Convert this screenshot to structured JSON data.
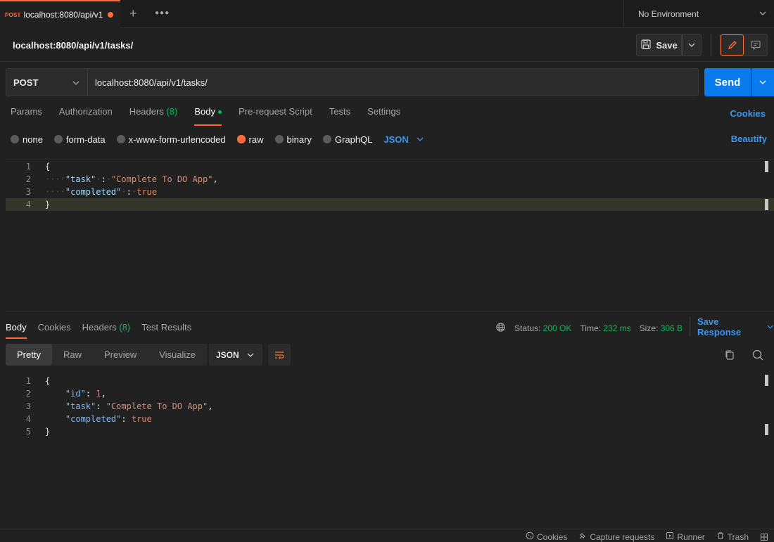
{
  "tab": {
    "method": "POST",
    "url": "localhost:8080/api/v1"
  },
  "environment": "No Environment",
  "request_name": "localhost:8080/api/v1/tasks/",
  "save_label": "Save",
  "method": "POST",
  "url": "localhost:8080/api/v1/tasks/",
  "send_label": "Send",
  "request_tabs": {
    "params": "Params",
    "authorization": "Authorization",
    "headers": "Headers",
    "headers_count": "(8)",
    "body": "Body",
    "prerequest": "Pre-request Script",
    "tests": "Tests",
    "settings": "Settings",
    "cookies": "Cookies"
  },
  "body_types": {
    "none": "none",
    "form_data": "form-data",
    "urlencoded": "x-www-form-urlencoded",
    "raw": "raw",
    "binary": "binary",
    "graphql": "GraphQL",
    "format": "JSON",
    "selected": "raw"
  },
  "beautify": "Beautify",
  "request_body": {
    "line_numbers": [
      "1",
      "2",
      "3",
      "4"
    ],
    "open_brace": "{",
    "close_brace": "}",
    "k_task": "\"task\"",
    "v_task": "\"Complete To DO App\"",
    "k_completed": "\"completed\"",
    "v_completed": "true"
  },
  "response_tabs": {
    "body": "Body",
    "cookies": "Cookies",
    "headers": "Headers",
    "headers_count": "(8)",
    "test_results": "Test Results"
  },
  "response_status": {
    "status_label": "Status:",
    "status_value": "200 OK",
    "time_label": "Time:",
    "time_value": "232 ms",
    "size_label": "Size:",
    "size_value": "306 B"
  },
  "save_response": "Save Response",
  "view_modes": {
    "pretty": "Pretty",
    "raw": "Raw",
    "preview": "Preview",
    "visualize": "Visualize"
  },
  "response_format": "JSON",
  "response_body": {
    "line_numbers": [
      "1",
      "2",
      "3",
      "4",
      "5"
    ],
    "open_brace": "{",
    "close_brace": "}",
    "k_id": "\"id\"",
    "v_id": "1",
    "k_task": "\"task\"",
    "v_task": "\"Complete To DO App\"",
    "k_completed": "\"completed\"",
    "v_completed": "true"
  },
  "footer": {
    "cookies": "Cookies",
    "capture": "Capture requests",
    "runner": "Runner",
    "trash": "Trash"
  },
  "colors": {
    "accent": "#ff6c37",
    "primary": "#097bed",
    "link": "#3d95ef",
    "success": "#0cbb52"
  }
}
